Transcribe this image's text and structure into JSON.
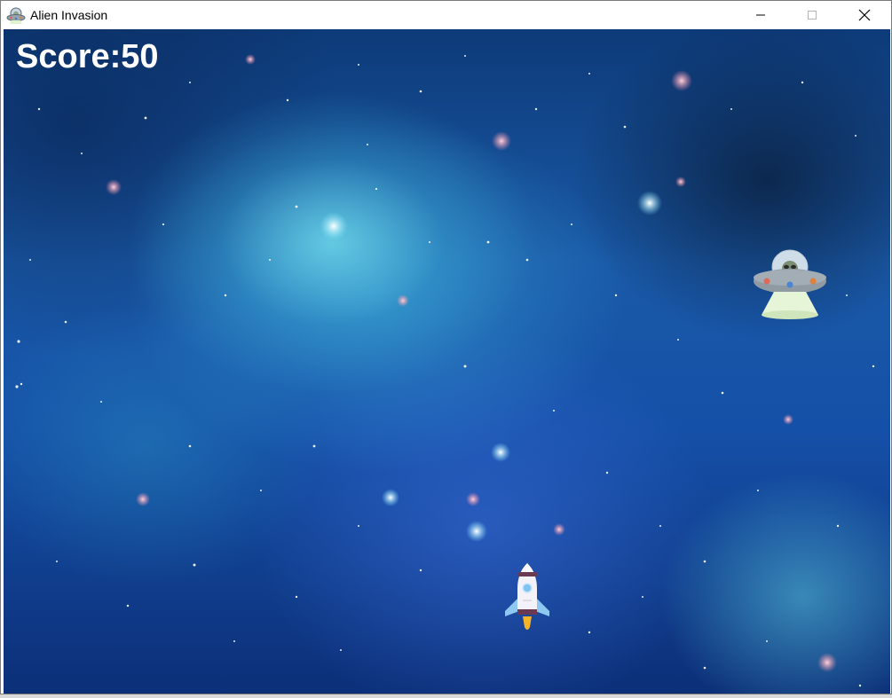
{
  "window": {
    "title": "Alien Invasion",
    "app_icon": "alien-ufo-icon",
    "controls": [
      "minimize-icon",
      "maximize-icon",
      "close-icon"
    ]
  },
  "hud": {
    "score_text": "Score:50"
  },
  "sprites": {
    "player": "rocket-ship",
    "enemy": "alien-ufo"
  },
  "colors": {
    "space_dark": "#0c2f78",
    "space_light": "#78e6f0",
    "score_text": "#ffffff",
    "ufo_body": "#8f9aa3",
    "ufo_beam": "#dff2d0",
    "rocket_body": "#f2f2f8",
    "rocket_accent": "#6a3a52",
    "rocket_fins": "#8ec8f0",
    "rocket_flame": "#f5b326"
  }
}
